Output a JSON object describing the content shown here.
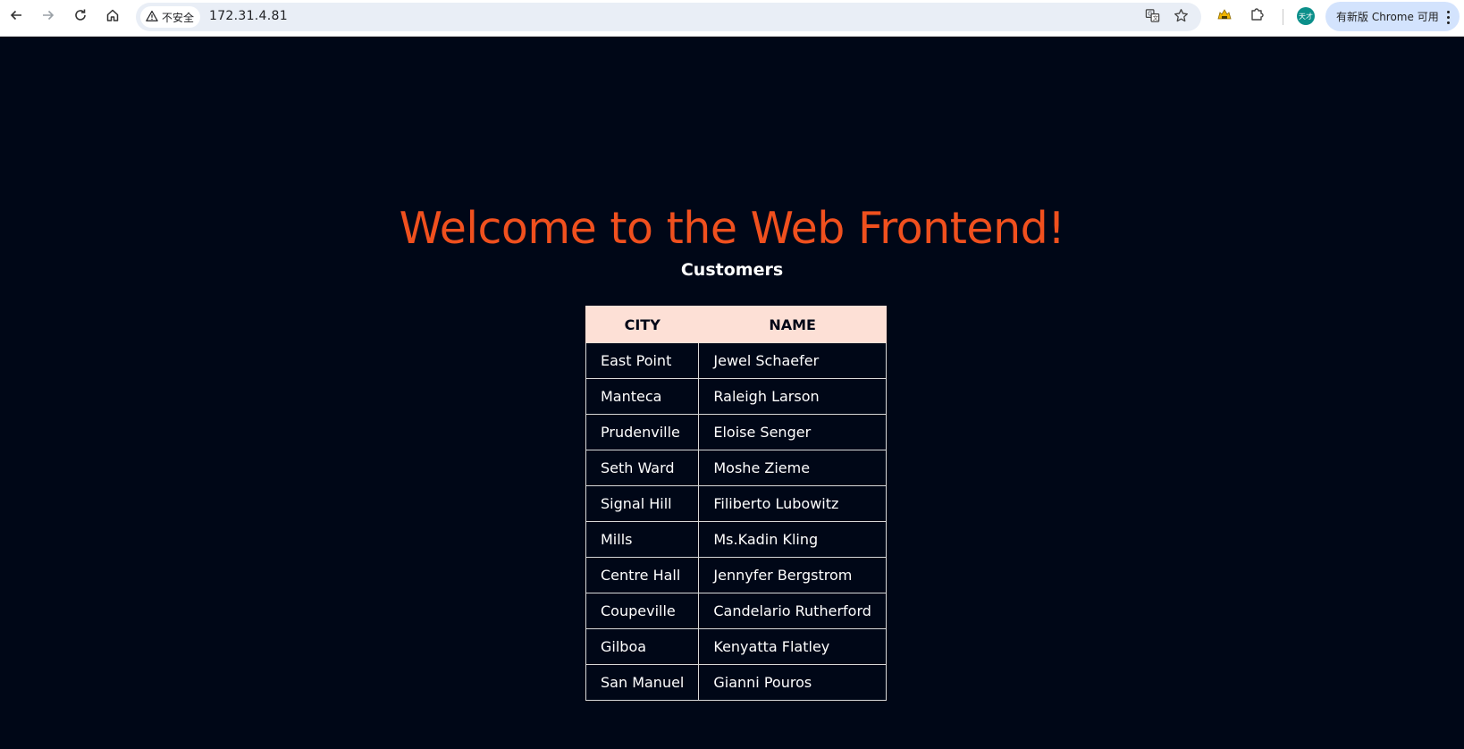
{
  "browser": {
    "security_label": "不安全",
    "url": "172.31.4.81",
    "update_label": "有新版 Chrome 可用",
    "profile_initials": "天才",
    "icons": {
      "back": "arrow-left-icon",
      "forward": "arrow-right-icon",
      "reload": "reload-icon",
      "home": "home-icon",
      "warning": "warning-triangle-icon",
      "translate": "translate-icon",
      "bookmark": "star-icon",
      "extension_app": "cat-extension-icon",
      "extensions": "puzzle-icon",
      "menu": "kebab-menu-icon"
    }
  },
  "page": {
    "title": "Welcome to the Web Frontend!",
    "section_title": "Customers",
    "colors": {
      "background": "#000717",
      "title": "#f0501e",
      "header_bg": "#fde0d6",
      "text": "#ffffff"
    },
    "table": {
      "headers": [
        "CITY",
        "NAME"
      ],
      "rows": [
        {
          "city": "East Point",
          "name": "Jewel Schaefer"
        },
        {
          "city": "Manteca",
          "name": "Raleigh Larson"
        },
        {
          "city": "Prudenville",
          "name": "Eloise Senger"
        },
        {
          "city": "Seth Ward",
          "name": "Moshe Zieme"
        },
        {
          "city": "Signal Hill",
          "name": "Filiberto Lubowitz"
        },
        {
          "city": "Mills",
          "name": "Ms.Kadin Kling"
        },
        {
          "city": "Centre Hall",
          "name": "Jennyfer Bergstrom"
        },
        {
          "city": "Coupeville",
          "name": "Candelario Rutherford"
        },
        {
          "city": "Gilboa",
          "name": "Kenyatta Flatley"
        },
        {
          "city": "San Manuel",
          "name": "Gianni Pouros"
        }
      ]
    }
  }
}
